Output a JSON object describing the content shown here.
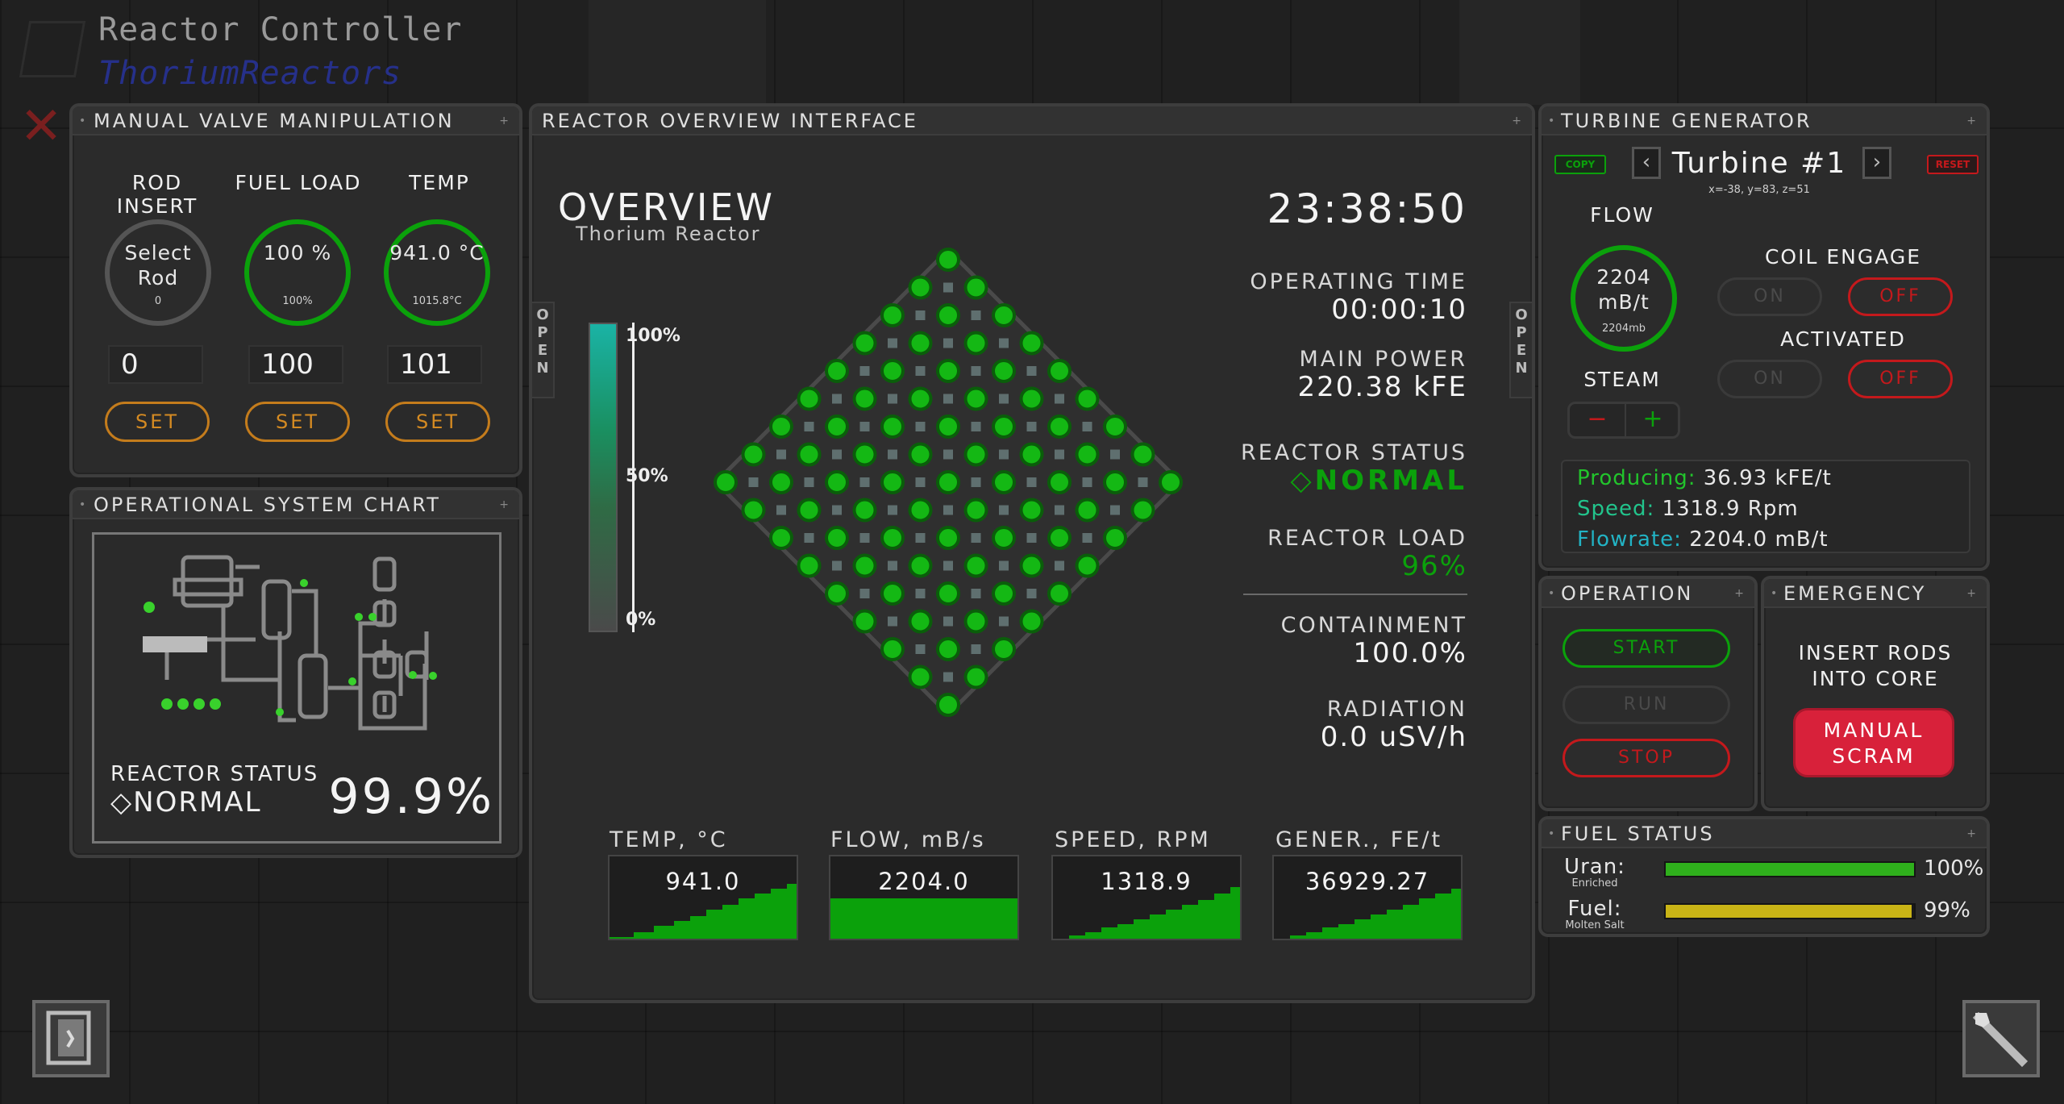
{
  "app": {
    "title": "Reactor Controller",
    "subtitle": "ThoriumReactors"
  },
  "manual_valve": {
    "title": "MANUAL VALVE MANIPULATION",
    "columns": [
      {
        "label": "ROD INSERT",
        "gauge_value": "Select Rod",
        "gauge_sub": "0",
        "input": "0",
        "button": "SET"
      },
      {
        "label": "FUEL LOAD",
        "gauge_value": "100 %",
        "gauge_sub": "100%",
        "input": "100",
        "button": "SET"
      },
      {
        "label": "TEMP",
        "gauge_value": "941.0 °C",
        "gauge_sub": "1015.8°C",
        "input": "101",
        "button": "SET"
      }
    ]
  },
  "system_chart": {
    "title": "OPERATIONAL SYSTEM CHART",
    "status_label": "REACTOR STATUS",
    "status_value": "NORMAL",
    "percent": "99.9%"
  },
  "overview": {
    "panel_title": "REACTOR OVERVIEW INTERFACE",
    "heading": "OVERVIEW",
    "subheading": "Thorium Reactor",
    "clock": "23:38:50",
    "open_tab": "OPEN",
    "scale": {
      "top": "100%",
      "mid": "50%",
      "bottom": "0%"
    },
    "stats": [
      {
        "label": "OPERATING TIME",
        "value": "00:00:10"
      },
      {
        "label": "MAIN POWER",
        "value": "220.38 kFE"
      },
      {
        "label": "REACTOR STATUS",
        "value": "◇NORMAL"
      },
      {
        "label": "REACTOR LOAD",
        "value": "96%"
      },
      {
        "label": "CONTAINMENT",
        "value": "100.0%"
      },
      {
        "label": "RADIATION",
        "value": "0.0 uSV/h"
      }
    ],
    "mini_charts": [
      {
        "label": "TEMP, °C",
        "value": "941.0"
      },
      {
        "label": "FLOW, mB/s",
        "value": "2204.0"
      },
      {
        "label": "SPEED, RPM",
        "value": "1318.9"
      },
      {
        "label": "GENER., FE/t",
        "value": "36929.27"
      }
    ]
  },
  "turbine": {
    "title": "TURBINE GENERATOR",
    "copy_label": "COPY",
    "reset_label": "RESET",
    "name": "Turbine #1",
    "coords": "x=-38, y=83, z=51",
    "flow_label": "FLOW",
    "flow_value": "2204 mB/t",
    "flow_sub": "2204mb",
    "steam_label": "STEAM",
    "minus": "−",
    "plus": "+",
    "coil_label": "COIL ENGAGE",
    "activated_label": "ACTIVATED",
    "on": "ON",
    "off": "OFF",
    "producing_label": "Producing:",
    "producing_value": "36.93 kFE/t",
    "speed_label": "Speed:",
    "speed_value": "1318.9 Rpm",
    "flowrate_label": "Flowrate:",
    "flowrate_value": "2204.0 mB/t"
  },
  "operation": {
    "title": "OPERATION",
    "start": "START",
    "run": "RUN",
    "stop": "STOP"
  },
  "emergency": {
    "title": "EMERGENCY",
    "text": "INSERT RODS INTO CORE",
    "button": "MANUAL SCRAM"
  },
  "fuel_status": {
    "title": "FUEL STATUS",
    "rows": [
      {
        "label": "Uran:",
        "sub": "Enriched",
        "percent": "100%",
        "level": 1.0,
        "color": "#2fb01c"
      },
      {
        "label": "Fuel:",
        "sub": "Molten Salt",
        "percent": "99%",
        "level": 0.99,
        "color": "#c9b416"
      }
    ]
  },
  "colors": {
    "green": "#0ba10b",
    "red": "#c4191c",
    "orange": "#c47c1c",
    "cyan": "#22b3a8"
  },
  "corner_icons": {
    "left": "book-icon",
    "right": "wrench-icon"
  }
}
